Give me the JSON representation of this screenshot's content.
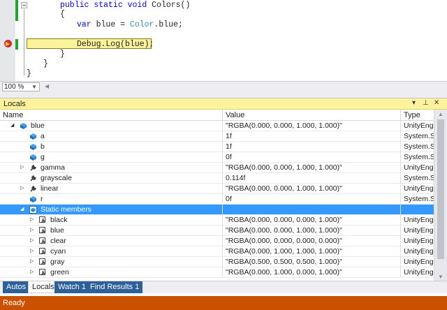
{
  "editor": {
    "lines": [
      {
        "kind": "method_sig",
        "parts": [
          {
            "t": "public ",
            "c": "kw"
          },
          {
            "t": "static ",
            "c": "kw"
          },
          {
            "t": "void ",
            "c": "kw"
          },
          {
            "t": "Colors()",
            "c": ""
          }
        ]
      },
      {
        "kind": "plain",
        "text": "{"
      },
      {
        "kind": "decl",
        "parts": [
          {
            "t": "var ",
            "c": "kw"
          },
          {
            "t": "blue = ",
            "c": ""
          },
          {
            "t": "Color",
            "c": "ty"
          },
          {
            "t": ".blue;",
            "c": ""
          }
        ]
      },
      {
        "kind": "blank",
        "text": ""
      },
      {
        "kind": "current",
        "text": "Debug.Log(blue);"
      },
      {
        "kind": "plain",
        "text": "}"
      },
      {
        "kind": "plain",
        "text": "}"
      },
      {
        "kind": "plain",
        "text": "}"
      }
    ],
    "zoom": "100 %"
  },
  "panel": {
    "title": "Locals",
    "columns": {
      "name": "Name",
      "value": "Value",
      "type": "Type"
    },
    "rows": [
      {
        "name": "blue",
        "value": "\"RGBA(0.000, 0.000, 1.000, 1.000)\"",
        "type": "UnityEng",
        "level": 0,
        "exp": "open",
        "icon": "object-icon"
      },
      {
        "name": "a",
        "value": "1f",
        "type": "System.S",
        "level": 1,
        "exp": "",
        "icon": "field-icon"
      },
      {
        "name": "b",
        "value": "1f",
        "type": "System.S",
        "level": 1,
        "exp": "",
        "icon": "field-icon"
      },
      {
        "name": "g",
        "value": "0f",
        "type": "System.S",
        "level": 1,
        "exp": "",
        "icon": "field-icon"
      },
      {
        "name": "gamma",
        "value": "\"RGBA(0.000, 0.000, 1.000, 1.000)\"",
        "type": "UnityEng",
        "level": 1,
        "exp": "closed",
        "icon": "property-icon"
      },
      {
        "name": "grayscale",
        "value": "0.114f",
        "type": "System.S",
        "level": 1,
        "exp": "",
        "icon": "property-icon"
      },
      {
        "name": "linear",
        "value": "\"RGBA(0.000, 0.000, 1.000, 1.000)\"",
        "type": "UnityEng",
        "level": 1,
        "exp": "closed",
        "icon": "property-icon"
      },
      {
        "name": "r",
        "value": "0f",
        "type": "System.S",
        "level": 1,
        "exp": "",
        "icon": "field-icon"
      },
      {
        "name": "Static members",
        "value": "",
        "type": "",
        "level": 1,
        "exp": "open",
        "icon": "static-members-icon",
        "selected": true
      },
      {
        "name": "black",
        "value": "\"RGBA(0.000, 0.000, 0.000, 1.000)\"",
        "type": "UnityEng",
        "level": 2,
        "exp": "closed",
        "icon": "static-property-icon"
      },
      {
        "name": "blue",
        "value": "\"RGBA(0.000, 0.000, 1.000, 1.000)\"",
        "type": "UnityEng",
        "level": 2,
        "exp": "closed",
        "icon": "static-property-icon"
      },
      {
        "name": "clear",
        "value": "\"RGBA(0.000, 0.000, 0.000, 0.000)\"",
        "type": "UnityEng",
        "level": 2,
        "exp": "closed",
        "icon": "static-property-icon"
      },
      {
        "name": "cyan",
        "value": "\"RGBA(0.000, 1.000, 1.000, 1.000)\"",
        "type": "UnityEng",
        "level": 2,
        "exp": "closed",
        "icon": "static-property-icon"
      },
      {
        "name": "gray",
        "value": "\"RGBA(0.500, 0.500, 0.500, 1.000)\"",
        "type": "UnityEng",
        "level": 2,
        "exp": "closed",
        "icon": "static-property-icon"
      },
      {
        "name": "green",
        "value": "\"RGBA(0.000, 1.000, 0.000, 1.000)\"",
        "type": "UnityEng",
        "level": 2,
        "exp": "closed",
        "icon": "static-property-icon"
      }
    ]
  },
  "tabs": [
    {
      "label": "Autos",
      "active": false
    },
    {
      "label": "Locals",
      "active": true
    },
    {
      "label": "Watch 1",
      "active": false
    },
    {
      "label": "Find Results 1",
      "active": false
    }
  ],
  "status": "Ready",
  "colors": {
    "accent": "#3399ff",
    "status_bar": "#ca5100",
    "panel_title": "#fff29d",
    "highlight": "#fbf39a"
  }
}
